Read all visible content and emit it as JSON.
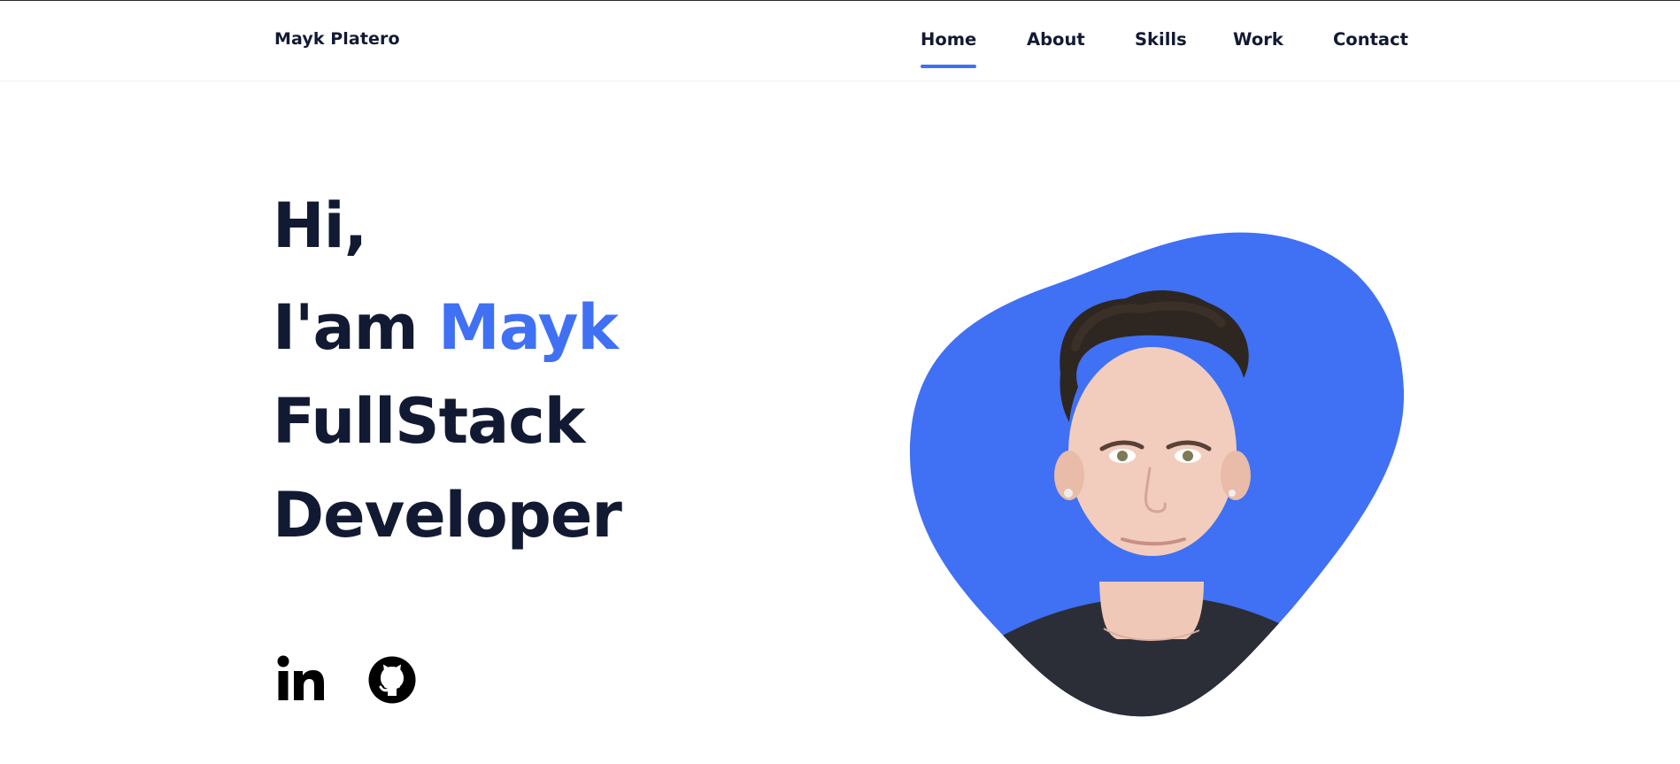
{
  "header": {
    "logo": "Mayk Platero",
    "nav": [
      {
        "label": "Home",
        "active": true
      },
      {
        "label": "About",
        "active": false
      },
      {
        "label": "Skills",
        "active": false
      },
      {
        "label": "Work",
        "active": false
      },
      {
        "label": "Contact",
        "active": false
      }
    ]
  },
  "hero": {
    "line1": "Hi,",
    "line2_prefix": "I'am ",
    "line2_name": "Mayk",
    "line3": "FullStack",
    "line4": "Developer"
  },
  "social": {
    "linkedin_icon": "linkedin-icon",
    "github_icon": "github-icon"
  },
  "colors": {
    "accent": "#4070f4",
    "text": "#121a33"
  }
}
